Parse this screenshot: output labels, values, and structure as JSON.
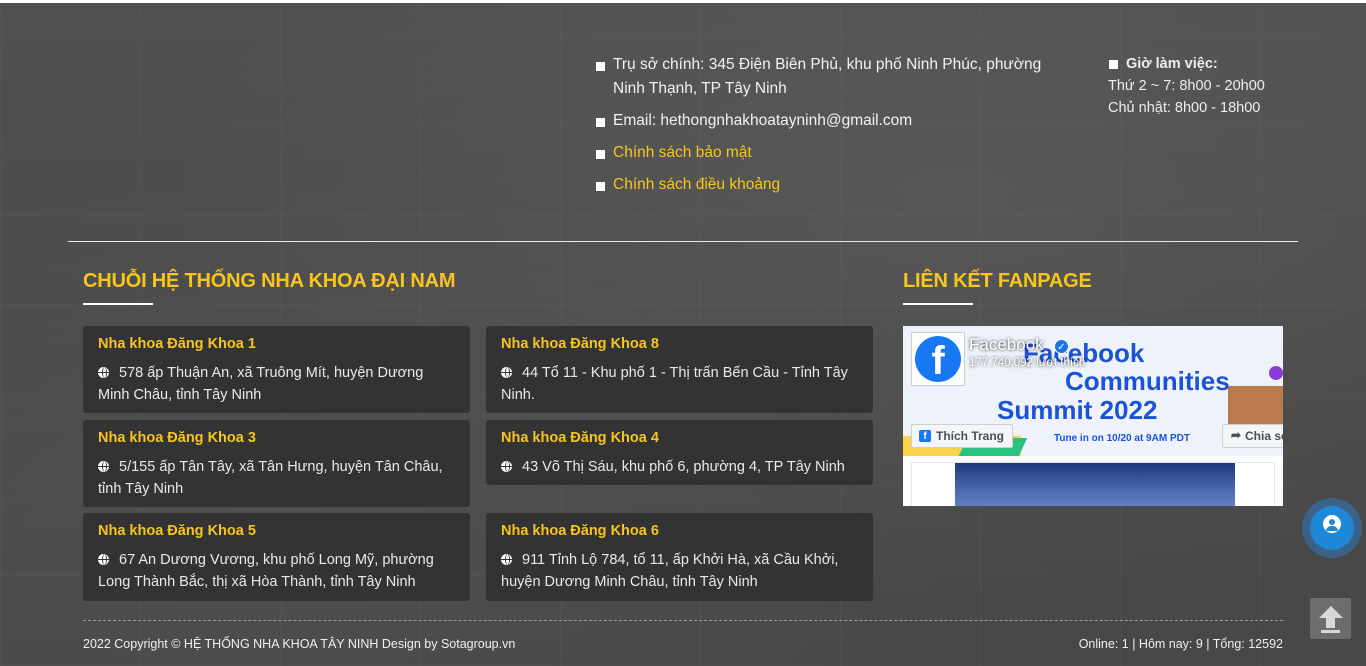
{
  "contact": {
    "address": "Trụ sở chính: 345 Điện Biên Phủ, khu phố Ninh Phúc, phường Ninh Thạnh, TP Tây Ninh",
    "email": "Email: hethongnhakhoatayninh@gmail.com",
    "privacy_link": "Chính sách bảo mật",
    "terms_link": "Chính sách điều khoảng"
  },
  "hours": {
    "title": "Giờ làm việc:",
    "weekday": "Thứ 2 ~ 7: 8h00 - 20h00",
    "sunday": "Chủ nhật: 8h00 - 18h00"
  },
  "chain": {
    "title": "CHUỖI HỆ THỐNG NHA KHOA ĐẠI NAM",
    "clinics": [
      {
        "name": "Nha khoa Đăng Khoa 1",
        "address": "578 ấp Thuận An, xã Truông Mít, huyện Dương Minh Châu, tỉnh Tây Ninh"
      },
      {
        "name": "Nha khoa Đăng Khoa 8",
        "address": "44 Tổ 11 - Khu phố 1 - Thị trấn Bến Cầu - Tỉnh Tây Ninh."
      },
      {
        "name": "Nha khoa Đăng Khoa 3",
        "address": "5/155 ấp Tân Tây, xã Tân Hưng, huyện Tân Châu, tỉnh Tây Ninh"
      },
      {
        "name": "Nha khoa Đăng Khoa 4",
        "address": "43 Võ Thị Sáu, khu phố 6, phường 4, TP Tây Ninh"
      },
      {
        "name": "Nha khoa Đăng Khoa 5",
        "address": "67 An Dương Vương, khu phố Long Mỹ, phường Long Thành Bắc, thị xã Hòa Thành, tỉnh Tây Ninh"
      },
      {
        "name": "Nha khoa Đăng Khoa 6",
        "address": "911 Tỉnh Lộ 784, tổ 11, ấp Khởi Hà, xã Cầu Khởi, huyện Dương Minh Châu, tỉnh Tây Ninh"
      }
    ]
  },
  "fanpage": {
    "title": "LIÊN KẾT FANPAGE",
    "page_name": "Facebook",
    "likes": "177.740.092 lượt thích",
    "like_button": "Thích Trang",
    "share_button": "Chia sẻ",
    "cover_line1": "Facebook",
    "cover_line2": "Communities",
    "cover_line3": "Summit 2022",
    "cover_tune": "Tune in on 10/20 at 9AM PDT"
  },
  "footer": {
    "copyright": "2022 Copyright © HỆ THỐNG NHA KHOA TÂY NINH Design by Sotagroup.vn",
    "stats": "Online: 1 | Hôm nay: 9 | Tổng: 12592"
  },
  "icons": {
    "bullet": "square-bullet-icon",
    "clinic_address": "globe-icon",
    "chat": "user-chat-icon",
    "back_to_top": "arrow-up-icon"
  },
  "colors": {
    "accent": "#f7c51d",
    "card_bg": "#333333",
    "facebook_blue": "#1877f2"
  }
}
